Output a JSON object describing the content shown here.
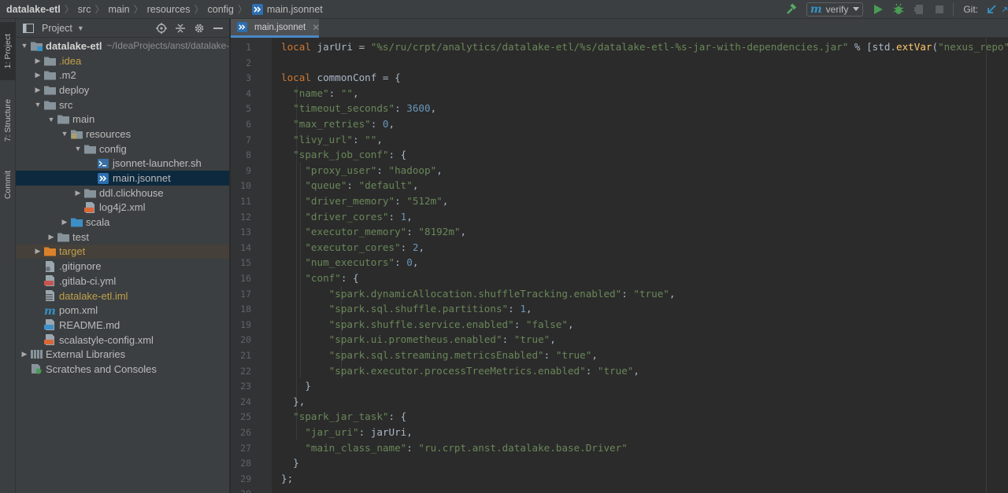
{
  "breadcrumb": {
    "items": [
      "datalake-etl",
      "src",
      "main",
      "resources",
      "config"
    ],
    "file": "main.jsonnet"
  },
  "toolbar": {
    "run_config": "verify",
    "git_label": "Git:"
  },
  "left_strip": {
    "tabs": [
      "1: Project",
      "7: Structure",
      "Commit"
    ]
  },
  "project_panel": {
    "title": "Project",
    "tree": [
      {
        "name": "datalake-etl",
        "path": "~/IdeaProjects/anst/datalake-etl",
        "depth": 0,
        "arrow": "open",
        "icon": "module-folder",
        "style": "bold"
      },
      {
        "name": ".idea",
        "depth": 1,
        "arrow": "closed",
        "icon": "folder",
        "style": "excluded"
      },
      {
        "name": ".m2",
        "depth": 1,
        "arrow": "closed",
        "icon": "folder",
        "style": "normal"
      },
      {
        "name": "deploy",
        "depth": 1,
        "arrow": "closed",
        "icon": "folder",
        "style": "normal"
      },
      {
        "name": "src",
        "depth": 1,
        "arrow": "open",
        "icon": "folder",
        "style": "normal"
      },
      {
        "name": "main",
        "depth": 2,
        "arrow": "open",
        "icon": "folder",
        "style": "normal"
      },
      {
        "name": "resources",
        "depth": 3,
        "arrow": "open",
        "icon": "resources-folder",
        "style": "normal"
      },
      {
        "name": "config",
        "depth": 4,
        "arrow": "open",
        "icon": "folder",
        "style": "normal"
      },
      {
        "name": "jsonnet-launcher.sh",
        "depth": 5,
        "arrow": "none",
        "icon": "shell-file",
        "style": "normal"
      },
      {
        "name": "main.jsonnet",
        "depth": 5,
        "arrow": "none",
        "icon": "jsonnet-file",
        "style": "normal",
        "selected": true
      },
      {
        "name": "ddl.clickhouse",
        "depth": 4,
        "arrow": "closed",
        "icon": "folder",
        "style": "normal"
      },
      {
        "name": "log4j2.xml",
        "depth": 4,
        "arrow": "none",
        "icon": "xml-file",
        "style": "normal"
      },
      {
        "name": "scala",
        "depth": 3,
        "arrow": "closed",
        "icon": "source-folder",
        "style": "normal"
      },
      {
        "name": "test",
        "depth": 2,
        "arrow": "closed",
        "icon": "folder",
        "style": "normal"
      },
      {
        "name": "target",
        "depth": 1,
        "arrow": "closed",
        "icon": "excluded-folder",
        "style": "excluded",
        "hilite": true
      },
      {
        "name": ".gitignore",
        "depth": 1,
        "arrow": "none",
        "icon": "gitignore-file",
        "style": "normal"
      },
      {
        "name": ".gitlab-ci.yml",
        "depth": 1,
        "arrow": "none",
        "icon": "yaml-file",
        "style": "normal"
      },
      {
        "name": "datalake-etl.iml",
        "depth": 1,
        "arrow": "none",
        "icon": "iml-file",
        "style": "excluded"
      },
      {
        "name": "pom.xml",
        "depth": 1,
        "arrow": "none",
        "icon": "maven-file",
        "style": "normal"
      },
      {
        "name": "README.md",
        "depth": 1,
        "arrow": "none",
        "icon": "markdown-file",
        "style": "normal"
      },
      {
        "name": "scalastyle-config.xml",
        "depth": 1,
        "arrow": "none",
        "icon": "xml-file",
        "style": "normal"
      },
      {
        "name": "External Libraries",
        "depth": 0,
        "arrow": "closed",
        "icon": "libraries",
        "style": "normal"
      },
      {
        "name": "Scratches and Consoles",
        "depth": 0,
        "arrow": "none",
        "icon": "scratches",
        "style": "normal"
      }
    ]
  },
  "editor": {
    "tab_label": "main.jsonnet",
    "lines": [
      [
        [
          "k",
          "local "
        ],
        [
          "p",
          "jarUri = "
        ],
        [
          "s",
          "\"%s/ru/crpt/analytics/datalake-etl/%s/datalake-etl-%s-jar-with-dependencies.jar\""
        ],
        [
          "p",
          " % [std."
        ],
        [
          "f",
          "extVar"
        ],
        [
          "p",
          "("
        ],
        [
          "s",
          "\"nexus_repo\""
        ],
        [
          "p",
          "),"
        ]
      ],
      [],
      [
        [
          "k",
          "local "
        ],
        [
          "p",
          "commonConf = {"
        ]
      ],
      [
        [
          "p",
          "  "
        ],
        [
          "s",
          "\"name\""
        ],
        [
          "p",
          ": "
        ],
        [
          "s",
          "\"\""
        ],
        [
          "p",
          ","
        ]
      ],
      [
        [
          "p",
          "  "
        ],
        [
          "s",
          "\"timeout_seconds\""
        ],
        [
          "p",
          ": "
        ],
        [
          "n",
          "3600"
        ],
        [
          "p",
          ","
        ]
      ],
      [
        [
          "p",
          "  "
        ],
        [
          "s",
          "\"max_retries\""
        ],
        [
          "p",
          ": "
        ],
        [
          "n",
          "0"
        ],
        [
          "p",
          ","
        ]
      ],
      [
        [
          "p",
          "  "
        ],
        [
          "s",
          "\"livy_url\""
        ],
        [
          "p",
          ": "
        ],
        [
          "s",
          "\"\""
        ],
        [
          "p",
          ","
        ]
      ],
      [
        [
          "p",
          "  "
        ],
        [
          "s",
          "\"spark_job_conf\""
        ],
        [
          "p",
          ": {"
        ]
      ],
      [
        [
          "p",
          "    "
        ],
        [
          "s",
          "\"proxy_user\""
        ],
        [
          "p",
          ": "
        ],
        [
          "s",
          "\"hadoop\""
        ],
        [
          "p",
          ","
        ]
      ],
      [
        [
          "p",
          "    "
        ],
        [
          "s",
          "\"queue\""
        ],
        [
          "p",
          ": "
        ],
        [
          "s",
          "\"default\""
        ],
        [
          "p",
          ","
        ]
      ],
      [
        [
          "p",
          "    "
        ],
        [
          "s",
          "\"driver_memory\""
        ],
        [
          "p",
          ": "
        ],
        [
          "s",
          "\"512m\""
        ],
        [
          "p",
          ","
        ]
      ],
      [
        [
          "p",
          "    "
        ],
        [
          "s",
          "\"driver_cores\""
        ],
        [
          "p",
          ": "
        ],
        [
          "n",
          "1"
        ],
        [
          "p",
          ","
        ]
      ],
      [
        [
          "p",
          "    "
        ],
        [
          "s",
          "\"executor_memory\""
        ],
        [
          "p",
          ": "
        ],
        [
          "s",
          "\"8192m\""
        ],
        [
          "p",
          ","
        ]
      ],
      [
        [
          "p",
          "    "
        ],
        [
          "s",
          "\"executor_cores\""
        ],
        [
          "p",
          ": "
        ],
        [
          "n",
          "2"
        ],
        [
          "p",
          ","
        ]
      ],
      [
        [
          "p",
          "    "
        ],
        [
          "s",
          "\"num_executors\""
        ],
        [
          "p",
          ": "
        ],
        [
          "n",
          "0"
        ],
        [
          "p",
          ","
        ]
      ],
      [
        [
          "p",
          "    "
        ],
        [
          "s",
          "\"conf\""
        ],
        [
          "p",
          ": {"
        ]
      ],
      [
        [
          "p",
          "        "
        ],
        [
          "s",
          "\"spark.dynamicAllocation.shuffleTracking.enabled\""
        ],
        [
          "p",
          ": "
        ],
        [
          "s",
          "\"true\""
        ],
        [
          "p",
          ","
        ]
      ],
      [
        [
          "p",
          "        "
        ],
        [
          "s",
          "\"spark.sql.shuffle.partitions\""
        ],
        [
          "p",
          ": "
        ],
        [
          "n",
          "1"
        ],
        [
          "p",
          ","
        ]
      ],
      [
        [
          "p",
          "        "
        ],
        [
          "s",
          "\"spark.shuffle.service.enabled\""
        ],
        [
          "p",
          ": "
        ],
        [
          "s",
          "\"false\""
        ],
        [
          "p",
          ","
        ]
      ],
      [
        [
          "p",
          "        "
        ],
        [
          "s",
          "\"spark.ui.prometheus.enabled\""
        ],
        [
          "p",
          ": "
        ],
        [
          "s",
          "\"true\""
        ],
        [
          "p",
          ","
        ]
      ],
      [
        [
          "p",
          "        "
        ],
        [
          "s",
          "\"spark.sql.streaming.metricsEnabled\""
        ],
        [
          "p",
          ": "
        ],
        [
          "s",
          "\"true\""
        ],
        [
          "p",
          ","
        ]
      ],
      [
        [
          "p",
          "        "
        ],
        [
          "s",
          "\"spark.executor.processTreeMetrics.enabled\""
        ],
        [
          "p",
          ": "
        ],
        [
          "s",
          "\"true\""
        ],
        [
          "p",
          ","
        ]
      ],
      [
        [
          "p",
          "    }"
        ]
      ],
      [
        [
          "p",
          "  },"
        ]
      ],
      [
        [
          "p",
          "  "
        ],
        [
          "s",
          "\"spark_jar_task\""
        ],
        [
          "p",
          ": {"
        ]
      ],
      [
        [
          "p",
          "    "
        ],
        [
          "s",
          "\"jar_uri\""
        ],
        [
          "p",
          ": jarUri,"
        ]
      ],
      [
        [
          "p",
          "    "
        ],
        [
          "s",
          "\"main_class_name\""
        ],
        [
          "p",
          ": "
        ],
        [
          "s",
          "\"ru.crpt.anst.datalake.base.Driver\""
        ]
      ],
      [
        [
          "p",
          "  }"
        ]
      ],
      [
        [
          "p",
          "};"
        ]
      ],
      []
    ],
    "line_numbers": [
      "1",
      "2",
      "3",
      "4",
      "5",
      "6",
      "7",
      "8",
      "9",
      "10",
      "11",
      "12",
      "13",
      "14",
      "15",
      "16",
      "17",
      "18",
      "19",
      "20",
      "21",
      "22",
      "23",
      "24",
      "25",
      "26",
      "27",
      "28",
      "29",
      "30"
    ],
    "fold_markers": [
      3,
      8,
      16,
      23,
      24,
      25,
      28,
      29
    ]
  },
  "colors": {
    "keyword": "#cc7832",
    "string": "#6a8759",
    "number": "#6897bb",
    "function": "#ffc66d",
    "plain": "#a9b7c6",
    "selection": "#0d293e",
    "accent": "#4a88c7"
  }
}
